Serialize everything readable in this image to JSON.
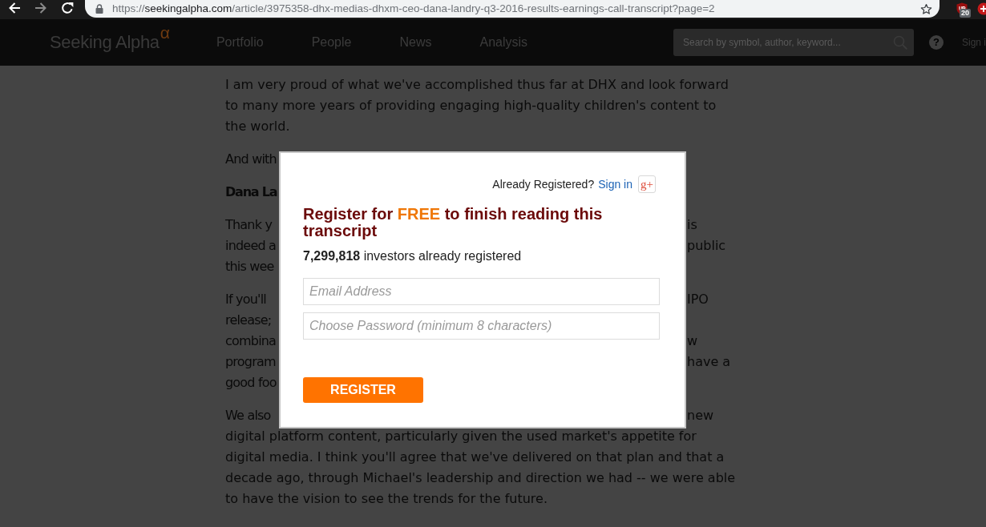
{
  "browser": {
    "nav_buttons": [
      {
        "kind": "back",
        "disabled": false
      },
      {
        "kind": "forward",
        "disabled": true
      },
      {
        "kind": "reload",
        "disabled": false
      }
    ],
    "address_bar": {
      "scheme": "https://",
      "host": "seekingalpha.com",
      "path": "/article/3975358-dhx-medias-dhxm-ceo-dana-landry-q3-2016-results-earnings-call-transcript?page=2"
    },
    "extensions": [
      {
        "kind": "shield",
        "badge": "20"
      },
      {
        "kind": "cross"
      }
    ]
  },
  "site_header": {
    "logo": {
      "text": "Seeking Alpha",
      "mark": "α"
    },
    "nav_items": [
      "Portfolio",
      "People",
      "News",
      "Analysis"
    ],
    "search": {
      "placeholder": "Search by symbol, author, keyword..."
    },
    "help": {
      "label": "?"
    },
    "sign_in": "Sign i"
  },
  "article": {
    "paragraphs": [
      {
        "kind": "text",
        "text": "I am very proud of what we've accomplished thus far at DHX and look forward to many more years of providing engaging high-quality children's content to the world."
      },
      {
        "kind": "text",
        "lines": [
          {
            "left": "And with"
          }
        ]
      },
      {
        "kind": "speaker",
        "lines": [
          {
            "left": "Dana La"
          }
        ]
      },
      {
        "kind": "text",
        "lines": [
          {
            "left": "Thank y",
            "right": "is"
          },
          {
            "left": "indeed a",
            "right": "public"
          },
          {
            "left": "this wee"
          }
        ]
      },
      {
        "kind": "text",
        "lines": [
          {
            "left": "If you'll",
            "right": "IPO"
          },
          {
            "left": "release;"
          },
          {
            "left": "combina",
            "right": "w"
          },
          {
            "left": "program",
            "right": "have a"
          },
          {
            "left": "good foo"
          }
        ]
      },
      {
        "kind": "text",
        "lines": [
          {
            "left": "We also",
            "right": "new"
          }
        ],
        "text": "digital platform content, particularly given the used market's appetite for digital media. I think you'll agree that we've delivered on that plan and that a decade ago, through Michael's leadership and direction we had -- we were able to have the vision to see the trends for the future."
      }
    ]
  },
  "modal": {
    "prompt": "Already Registered?",
    "sign_in_link": "Sign in",
    "social_button": "g+",
    "title": {
      "before": "Register for",
      "highlight": "FREE",
      "after": "to finish reading this transcript"
    },
    "count": "**7,299,818** investors already registered",
    "fields": [
      {
        "placeholder": "Email Address"
      },
      {
        "placeholder": "Choose Password (minimum 8 characters)"
      }
    ],
    "submit": "REGISTER"
  }
}
